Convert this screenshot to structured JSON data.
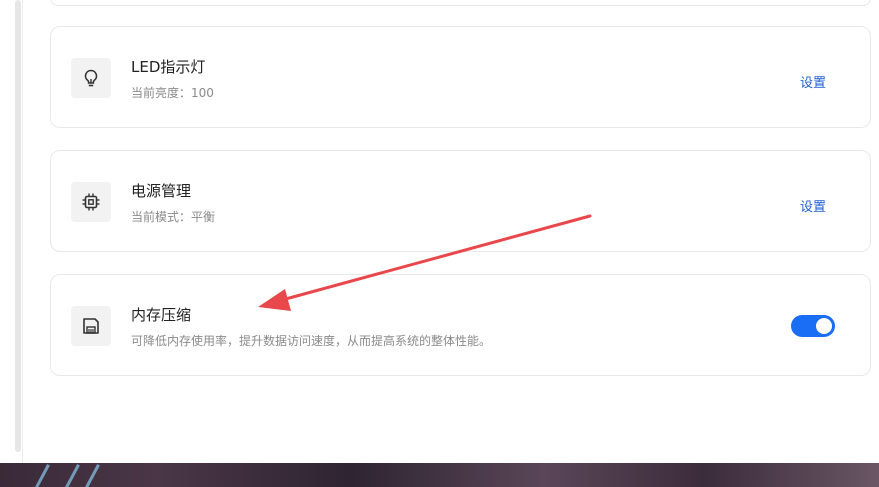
{
  "settings": [
    {
      "id": "led",
      "icon": "lightbulb-icon",
      "title": "LED指示灯",
      "subtitle": "当前亮度：100",
      "action_label": "设置"
    },
    {
      "id": "power",
      "icon": "chip-icon",
      "title": "电源管理",
      "subtitle": "当前模式：平衡",
      "action_label": "设置"
    },
    {
      "id": "memory",
      "icon": "floppy-disk-icon",
      "title": "内存压缩",
      "subtitle": "可降低内存使用率，提升数据访问速度，从而提高系统的整体性能。",
      "toggle_on": true
    }
  ],
  "colors": {
    "accent": "#1a6ef5",
    "link": "#1f5fd6",
    "annotation_arrow": "#e8474b"
  }
}
